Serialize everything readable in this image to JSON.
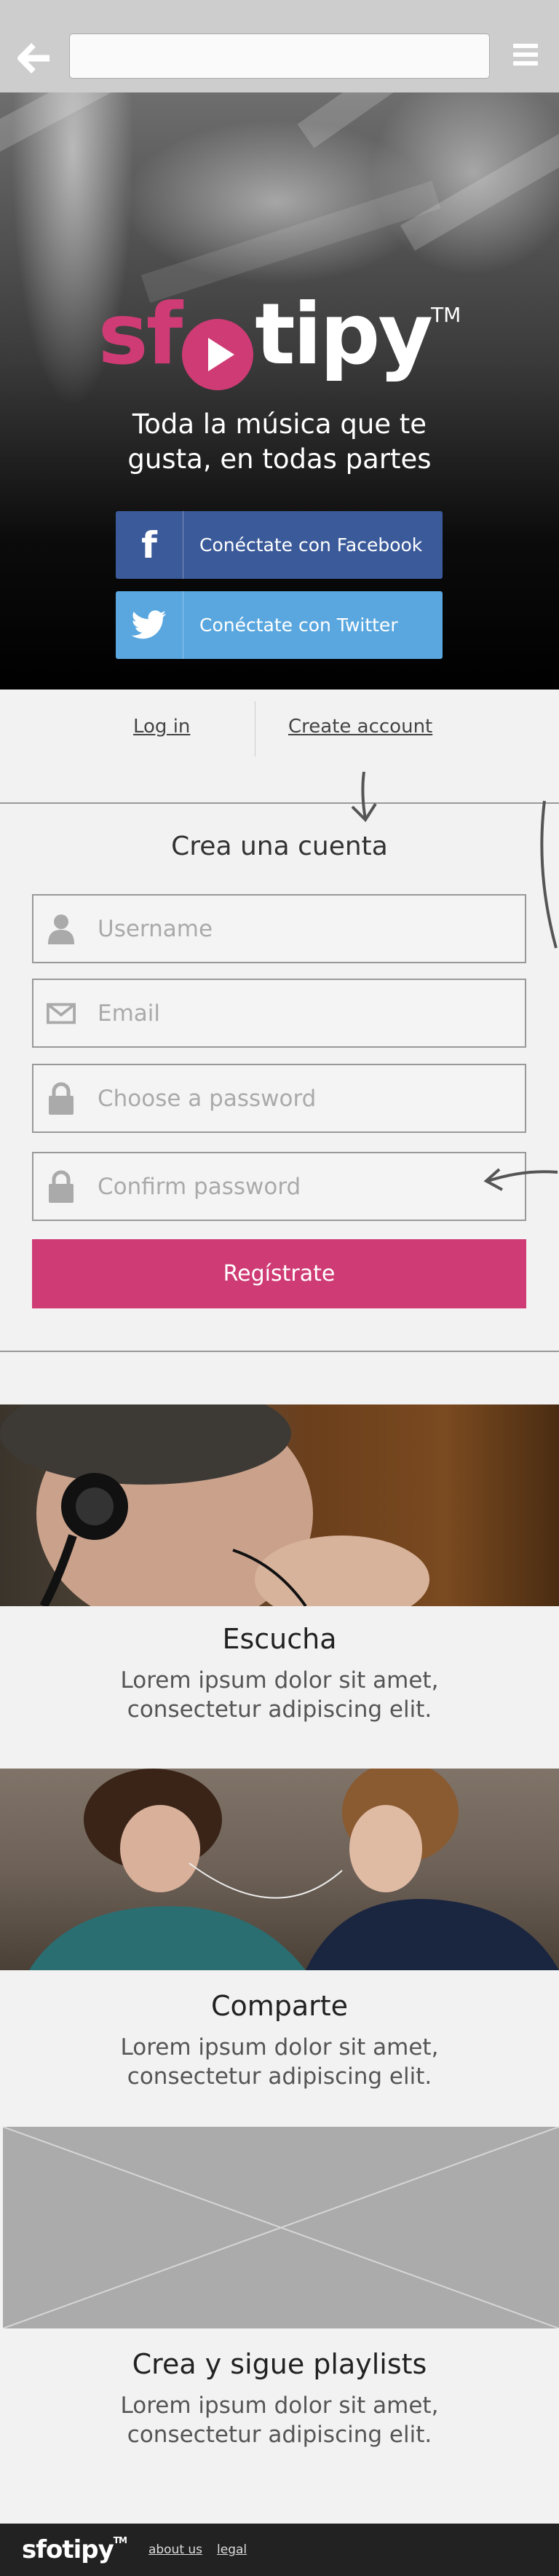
{
  "browser": {
    "url_value": ""
  },
  "hero": {
    "logo_pink": "sf",
    "logo_white": "tipy",
    "logo_tm": "TM",
    "tagline_line1": "Toda la música que te",
    "tagline_line2": "gusta, en todas partes",
    "facebook_label": "Conéctate con Facebook",
    "twitter_label": "Conéctate con Twitter",
    "facebook_icon": "f",
    "colors": {
      "brand_pink": "#cf3b74",
      "facebook": "#3b5a9a",
      "twitter": "#5aa7df"
    }
  },
  "tabs": {
    "login": "Log in",
    "create": "Create account"
  },
  "form": {
    "title": "Crea una cuenta",
    "username_placeholder": "Username",
    "email_placeholder": "Email",
    "password_placeholder": "Choose a password",
    "confirm_placeholder": "Confirm password",
    "submit_label": "Regístrate"
  },
  "features": [
    {
      "title": "Escucha",
      "text_line1": "Lorem ipsum dolor sit amet,",
      "text_line2": "consectetur adipiscing elit."
    },
    {
      "title": "Comparte",
      "text_line1": "Lorem ipsum dolor sit amet,",
      "text_line2": "consectetur adipiscing elit."
    },
    {
      "title": "Crea y sigue playlists",
      "text_line1": "Lorem ipsum dolor sit amet,",
      "text_line2": "consectetur adipiscing elit."
    }
  ],
  "footer": {
    "logo": "sfotipy",
    "logo_tm": "TM",
    "about": "about us",
    "legal": "legal"
  }
}
